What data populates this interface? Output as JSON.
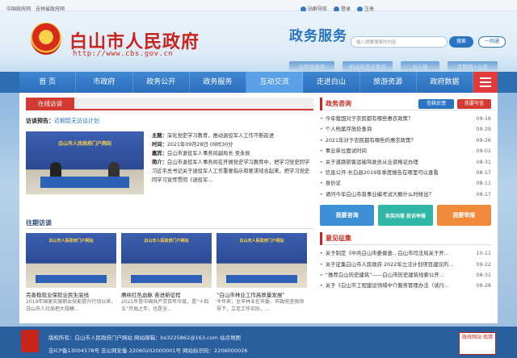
{
  "topbar": {
    "left": [
      "中国政府网",
      "吉林省政府网"
    ],
    "right": [
      "站群导航",
      "登录",
      "注册"
    ]
  },
  "header": {
    "title": "白山市人民政府",
    "url": "http://www.cbs.gov.cn",
    "service_title": "政务服务",
    "search_placeholder": "输入想要搜索的内容",
    "search_btn": "搜索",
    "onenet_btn": "一网通",
    "quick_links": [
      "公积金查询",
      "机动车违法查询",
      "出入境",
      "互联网+公安"
    ]
  },
  "nav": [
    "首 页",
    "市政府",
    "政务公开",
    "政务服务",
    "互动交流",
    "走进白山",
    "旅游资源",
    "政府数据"
  ],
  "interview": {
    "tab": "在线访谈",
    "preview_label": "访谈预告：",
    "preview_text": "近期暂无访谈计划",
    "banner": "白山市人民政府门户网站",
    "topic_k": "主题：",
    "topic": "深化党史学习教育，推动退役军人工作不断前进",
    "time_k": "时间：",
    "time": "2021年09月28日  09时30分",
    "guest_k": "嘉宾：",
    "guest": "白山市退役军人事务局副局长 吴永侯",
    "intro_k": "简介：",
    "intro": "白山市退役军人事务局在开展党史学习教育中，把学习党史同学习近平总书记关于退役军人工作重要指示和要求结合起来，把学习党史同学习宣传贯彻《退役军..."
  },
  "past": {
    "title": "往期访谈",
    "items": [
      {
        "banner": "白山市人民政府门户网站",
        "title": "完善稳就业保就业民生底线",
        "snippet": "2019年国家实施职业技能提升行动以来，白山市人社局把大规模..."
      },
      {
        "banner": "白山市人民政府门户网站",
        "title": "赓续红色血脉 奋进新征程",
        "snippet": "2021年是中国共产党百年华诞，是“十四五”开局之年，也是全..."
      },
      {
        "banner": "白山市人民政府门户网站",
        "title": "“白山市林业工作高质量发展”",
        "snippet": "今年来，全市林业在市委、市政府坚强领导下，立足工作实际，..."
      }
    ]
  },
  "consult": {
    "title": "政务咨询",
    "btn_letter": "信箱反馈",
    "btn_write": "我要写信",
    "items": [
      {
        "t": "今年我国对于农民都有哪些惠农政策？",
        "d": "09-16"
      },
      {
        "t": "个人档案存放处查询",
        "d": "09-29"
      },
      {
        "t": "2021年对于农民都有哪些的惠农政策？",
        "d": "09-26"
      },
      {
        "t": "事业单位面试时间",
        "d": "09-01"
      },
      {
        "t": "关于道路旅客运输驾驶员从业资格证办理",
        "d": "08-31"
      },
      {
        "t": "信息公开-长白县2019年季度报告在哪里可以查看",
        "d": "08-17"
      },
      {
        "t": "身份证",
        "d": "08-11"
      },
      {
        "t": "请问今年白山市直事业编考试大概什么时候出？",
        "d": "08-17"
      }
    ],
    "grid": [
      "我要咨询",
      "有奖问卷 投诉举报",
      "我要举报"
    ]
  },
  "opinion": {
    "title": "意见征集",
    "items": [
      {
        "t": "关于制定《中共白山市委督查…白山市司法局关于开...",
        "d": "10-11"
      },
      {
        "t": "关于征集白山市人民政府 2022年立法计划项目建议的...",
        "d": "09-22"
      },
      {
        "t": "“推荐白山历史建筑”——白山市历史建筑线索公开...",
        "d": "08-31"
      },
      {
        "t": "关于《白山市工程建设领域中介服务管理办法（试行...",
        "d": "08-28"
      }
    ]
  },
  "footer": {
    "line1": "版权所有：白山市人民政府门户网站    网站邮箱：bs3225862@163.com    站点地图",
    "line2": "吉ICP备13004578号    吉公网安备 22060202000001号    网站标识码：2206000026",
    "badge": "政府网站 找错"
  },
  "colors": {
    "brand_red": "#c8241b",
    "brand_blue": "#2a74c4"
  }
}
